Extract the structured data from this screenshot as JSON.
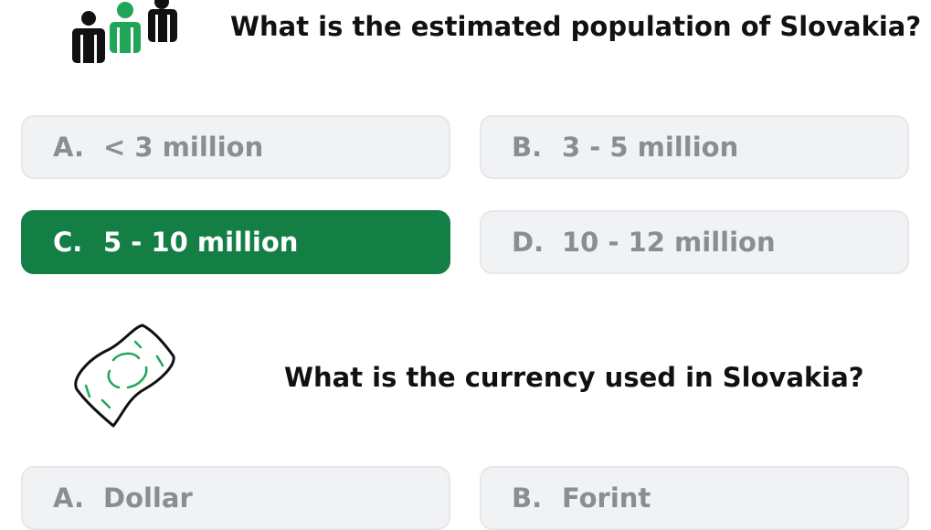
{
  "questions": [
    {
      "text": "What is the estimated population of Slovakia?",
      "icon": "people-icon",
      "options": [
        {
          "letter": "A.",
          "label": "< 3 million",
          "selected": false
        },
        {
          "letter": "B.",
          "label": "3 - 5 million",
          "selected": false
        },
        {
          "letter": "C.",
          "label": "5 - 10 million",
          "selected": true
        },
        {
          "letter": "D.",
          "label": "10 - 12 million",
          "selected": false
        }
      ]
    },
    {
      "text": "What is the currency used in Slovakia?",
      "icon": "banknote-icon",
      "options": [
        {
          "letter": "A.",
          "label": "Dollar",
          "selected": false
        },
        {
          "letter": "B.",
          "label": "Forint",
          "selected": false
        }
      ]
    }
  ],
  "colors": {
    "selected": "#137f45",
    "option_bg": "#f1f2f4",
    "option_text": "#8a8d91",
    "icon_accent": "#21a559"
  }
}
